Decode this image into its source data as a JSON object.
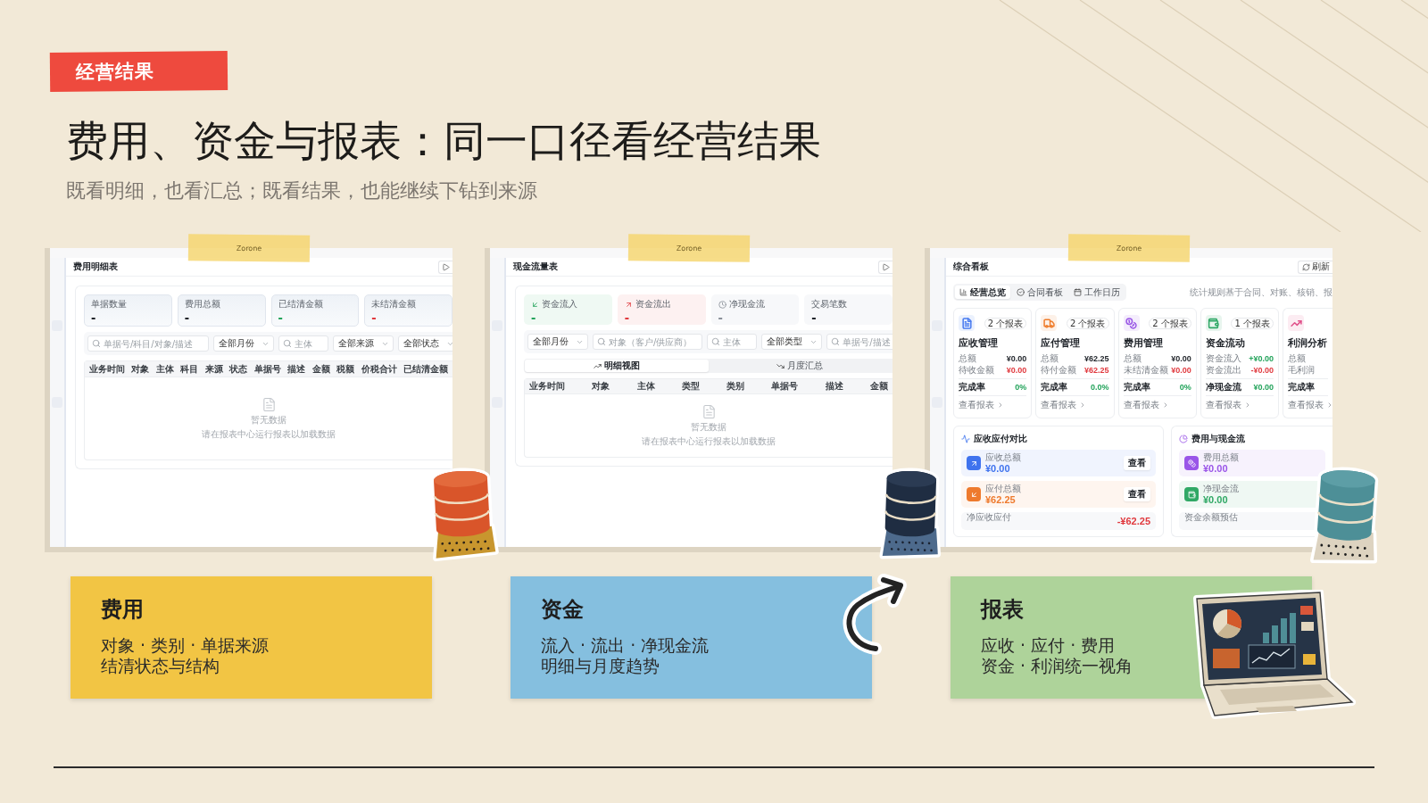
{
  "tag": "经营结果",
  "title": "费用、资金与报表：同一口径看经营结果",
  "subtitle": "既看明细，也看汇总；既看结果，也能继续下钻到来源",
  "screens": [
    {
      "kind": "table",
      "tape": "Zorone",
      "title": "费用明细表",
      "stats": [
        {
          "label": "单据数量",
          "value": "-",
          "color": "#1f2329"
        },
        {
          "label": "费用总额",
          "value": "-",
          "color": "#1f2329"
        },
        {
          "label": "已结清金额",
          "value": "-",
          "color": "#22a35a"
        },
        {
          "label": "未结清金额",
          "value": "-",
          "color": "#e0393e"
        }
      ],
      "filters": [
        {
          "kind": "search",
          "placeholder": "单据号/科目/对象/描述"
        },
        {
          "kind": "select",
          "value": "全部月份"
        },
        {
          "kind": "search",
          "placeholder": "主体"
        },
        {
          "kind": "select",
          "value": "全部来源"
        },
        {
          "kind": "select",
          "value": "全部状态"
        }
      ],
      "columns": [
        "业务时间",
        "对象",
        "主体",
        "科目",
        "来源",
        "状态",
        "单据号",
        "描述",
        "金额",
        "税额",
        "价税合计",
        "已结清金额"
      ],
      "empty": {
        "title": "暂无数据",
        "hint": "请在报表中心运行报表以加载数据"
      }
    },
    {
      "kind": "table",
      "tape": "Zorone",
      "title": "现金流量表",
      "stats": [
        {
          "kind": "inflow",
          "label": "资金流入",
          "value": "-",
          "color": "#22a35a"
        },
        {
          "kind": "outflow",
          "label": "资金流出",
          "value": "-",
          "color": "#e0393e"
        },
        {
          "kind": "net",
          "label": "净现金流",
          "value": "-",
          "color": "#8a9099"
        },
        {
          "kind": "count",
          "label": "交易笔数",
          "value": "-",
          "color": "#1f2329"
        }
      ],
      "filters": [
        {
          "kind": "select",
          "value": "全部月份"
        },
        {
          "kind": "search",
          "placeholder": "对象（客户/供应商）"
        },
        {
          "kind": "search",
          "placeholder": "主体"
        },
        {
          "kind": "select",
          "value": "全部类型"
        },
        {
          "kind": "search",
          "placeholder": "单据号/描述"
        }
      ],
      "views": [
        {
          "kind": "detail",
          "label": "明细视图",
          "selected": true
        },
        {
          "kind": "monthly",
          "label": "月度汇总",
          "selected": false
        }
      ],
      "columns": [
        "业务时间",
        "对象",
        "主体",
        "类型",
        "类别",
        "单据号",
        "描述",
        "金额"
      ],
      "empty": {
        "title": "暂无数据",
        "hint": "请在报表中心运行报表以加载数据"
      }
    },
    {
      "kind": "dashboard",
      "tape": "Zorone",
      "title": "综合看板",
      "action": "刷新",
      "tabs": [
        {
          "kind": "overview",
          "label": "经营总览",
          "selected": true
        },
        {
          "kind": "contracts",
          "label": "合同看板",
          "selected": false
        },
        {
          "kind": "calendar",
          "label": "工作日历",
          "selected": false
        }
      ],
      "note": "统计规则基于合同、对账、核销、报",
      "modules": [
        {
          "kind": "receivable",
          "title": "应收管理",
          "badge": "2 个报表",
          "color": "#4a7cf0",
          "rows": [
            {
              "label": "总额",
              "value": "¥0.00",
              "color": "#1f2329"
            },
            {
              "label": "待收金额",
              "value": "¥0.00",
              "color": "#e0393e"
            }
          ],
          "rate": {
            "label": "完成率",
            "value": "0%",
            "color": "#22a35a"
          },
          "link": "查看报表"
        },
        {
          "kind": "payable",
          "title": "应付管理",
          "badge": "2 个报表",
          "color": "#ef7d2c",
          "rows": [
            {
              "label": "总额",
              "value": "¥62.25",
              "color": "#1f2329"
            },
            {
              "label": "待付金额",
              "value": "¥62.25",
              "color": "#e0393e"
            }
          ],
          "rate": {
            "label": "完成率",
            "value": "0.0%",
            "color": "#22a35a"
          },
          "link": "查看报表"
        },
        {
          "kind": "expense",
          "title": "费用管理",
          "badge": "2 个报表",
          "color": "#9b59e6",
          "rows": [
            {
              "label": "总额",
              "value": "¥0.00",
              "color": "#1f2329"
            },
            {
              "label": "未结清金额",
              "value": "¥0.00",
              "color": "#e0393e"
            }
          ],
          "rate": {
            "label": "完成率",
            "value": "0%",
            "color": "#22a35a"
          },
          "link": "查看报表"
        },
        {
          "kind": "cash",
          "title": "资金流动",
          "badge": "1 个报表",
          "color": "#2fa866",
          "rows": [
            {
              "label": "资金流入",
              "value": "+¥0.00",
              "color": "#22a35a"
            },
            {
              "label": "资金流出",
              "value": "-¥0.00",
              "color": "#e0393e"
            }
          ],
          "rate": {
            "label": "净现金流",
            "value": "¥0.00",
            "color": "#22a35a"
          },
          "link": "查看报表"
        },
        {
          "kind": "profit",
          "title": "利润分析",
          "color": "#e0508a",
          "rows": [
            {
              "label": "总额"
            },
            {
              "label": "毛利润"
            }
          ],
          "rate": {
            "label": "完成率"
          },
          "link": "查看报表"
        }
      ],
      "panels": [
        {
          "kind": "compare",
          "title": "应收应付对比",
          "items": [
            {
              "kind": "receivable",
              "label": "应收总额",
              "value": "¥0.00",
              "color": "#3f73ee",
              "action": "查看"
            },
            {
              "kind": "payable",
              "label": "应付总额",
              "value": "¥62.25",
              "color": "#ee7a2d",
              "action": "查看"
            }
          ],
          "summary": {
            "label": "净应收应付",
            "value": "-¥62.25",
            "color": "#e0393e"
          }
        },
        {
          "kind": "cashflow",
          "title": "费用与现金流",
          "items": [
            {
              "kind": "expense",
              "label": "费用总额",
              "value": "¥0.00",
              "color": "#9a55e8"
            },
            {
              "kind": "cash",
              "label": "净现金流",
              "value": "¥0.00",
              "color": "#30a865"
            }
          ],
          "summary": {
            "label": "资金余额预估"
          }
        }
      ]
    }
  ],
  "cards": [
    {
      "title": "费用",
      "lines": [
        "对象 · 类别 · 单据来源",
        "结清状态与结构"
      ],
      "color": "#f2c544"
    },
    {
      "title": "资金",
      "lines": [
        "流入 · 流出 · 净现金流",
        "明细与月度趋势"
      ],
      "color": "#85bfdf"
    },
    {
      "title": "报表",
      "lines": [
        "应收 · 应付 · 费用",
        "资金 · 利润统一视角"
      ],
      "color": "#aed39a"
    }
  ]
}
